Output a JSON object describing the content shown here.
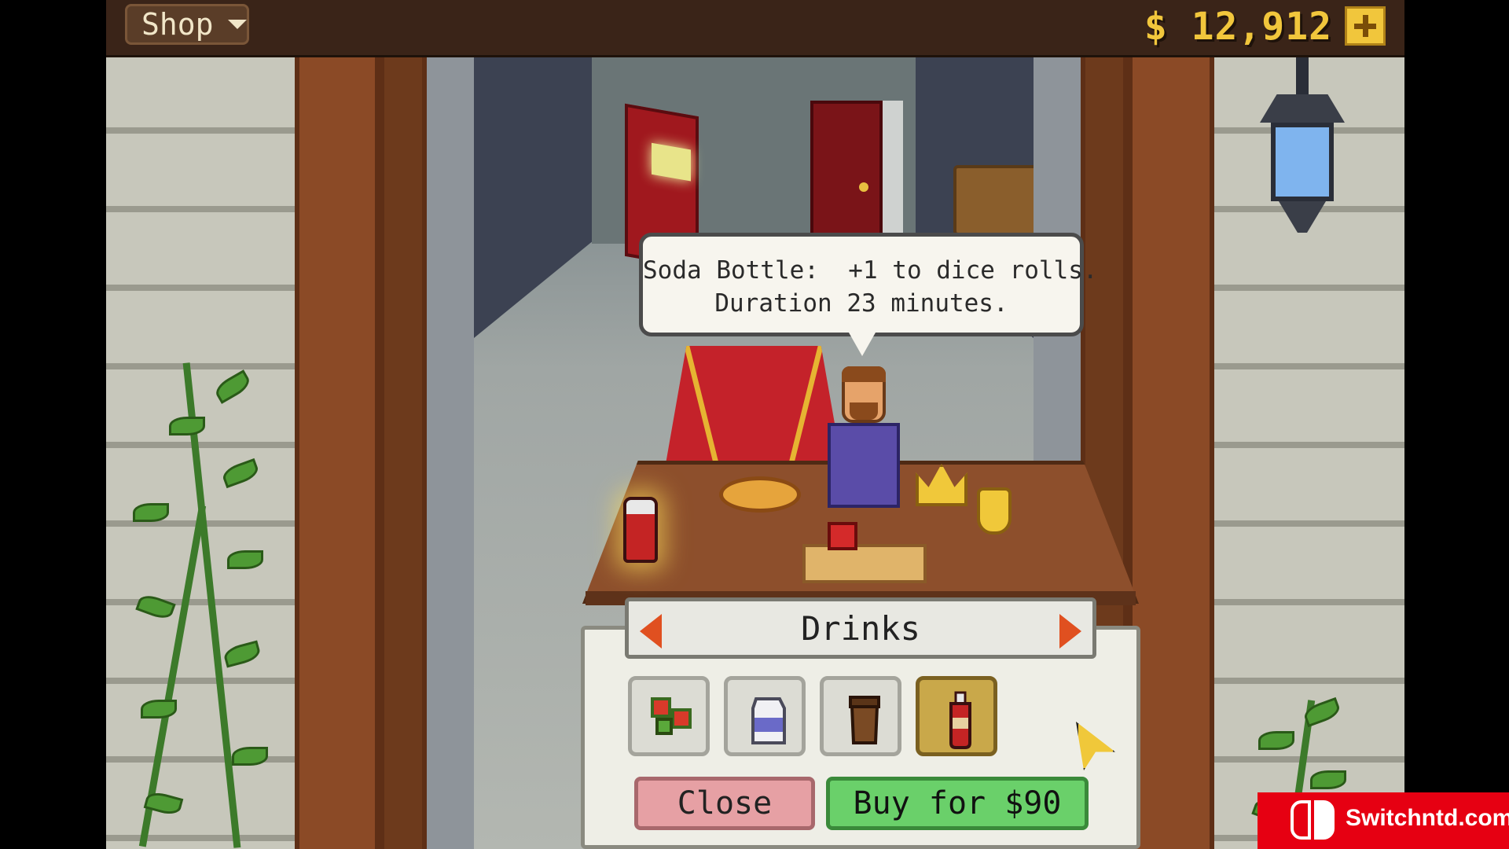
{
  "topbar": {
    "menu_label": "Shop",
    "money": "$ 12,912"
  },
  "speech": {
    "line1": "Soda Bottle:  +1 to dice rolls.",
    "line2": "Duration 23 minutes."
  },
  "shop": {
    "category": "Drinks",
    "items": [
      {
        "icon": "candy-icon"
      },
      {
        "icon": "milk-carton-icon"
      },
      {
        "icon": "coffee-icon"
      },
      {
        "icon": "soda-bottle-icon",
        "selected": true
      }
    ],
    "close_label": "Close",
    "buy_label": "Buy for $90"
  },
  "watermark": {
    "text": "Switchntd.com"
  },
  "colors": {
    "topbar_bg": "#3a2418",
    "money_gold": "#f1c63c",
    "close_button": "#e6a0a4",
    "buy_button": "#6ad06a",
    "category_arrow": "#e05020",
    "carpet": "#c4222a",
    "watermark_red": "#e60012"
  }
}
